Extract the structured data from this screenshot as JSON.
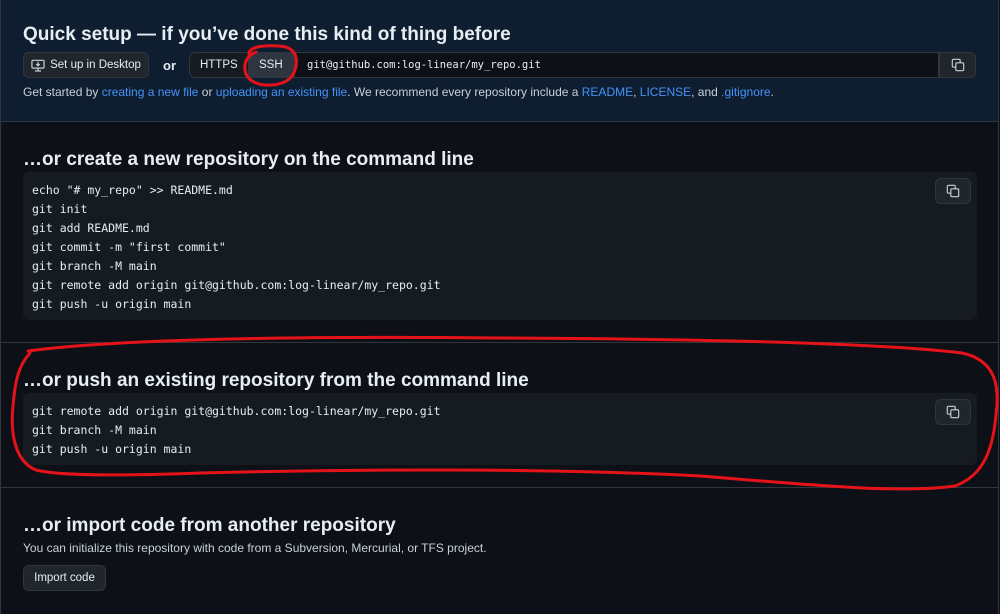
{
  "quick_setup": {
    "title": "Quick setup — if you’ve done this kind of thing before",
    "desktop_button": "Set up in Desktop",
    "or": "or",
    "protocols": [
      "HTTPS",
      "SSH"
    ],
    "selected_protocol": "SSH",
    "clone_url": "git@github.com:log-linear/my_repo.git",
    "help": {
      "t1": "Get started by ",
      "l1": "creating a new file",
      "t2": " or ",
      "l2": "uploading an existing file",
      "t3": ". We recommend every repository include a ",
      "l3": "README",
      "t4": ", ",
      "l4": "LICENSE",
      "t5": ", and ",
      "l5": ".gitignore",
      "t6": "."
    }
  },
  "create_section": {
    "title": "…or create a new repository on the command line",
    "lines": [
      "echo \"# my_repo\" >> README.md",
      "git init",
      "git add README.md",
      "git commit -m \"first commit\"",
      "git branch -M main",
      "git remote add origin git@github.com:log-linear/my_repo.git",
      "git push -u origin main"
    ]
  },
  "push_section": {
    "title": "…or push an existing repository from the command line",
    "lines": [
      "git remote add origin git@github.com:log-linear/my_repo.git",
      "git branch -M main",
      "git push -u origin main"
    ]
  },
  "import_section": {
    "title": "…or import code from another repository",
    "description": "You can initialize this repository with code from a Subversion, Mercurial, or TFS project.",
    "button": "Import code"
  },
  "colors": {
    "background": "#0d1117",
    "quick_setup_bg": "#0f1d30",
    "link": "#4493f8",
    "annotation": "#e5121a"
  }
}
